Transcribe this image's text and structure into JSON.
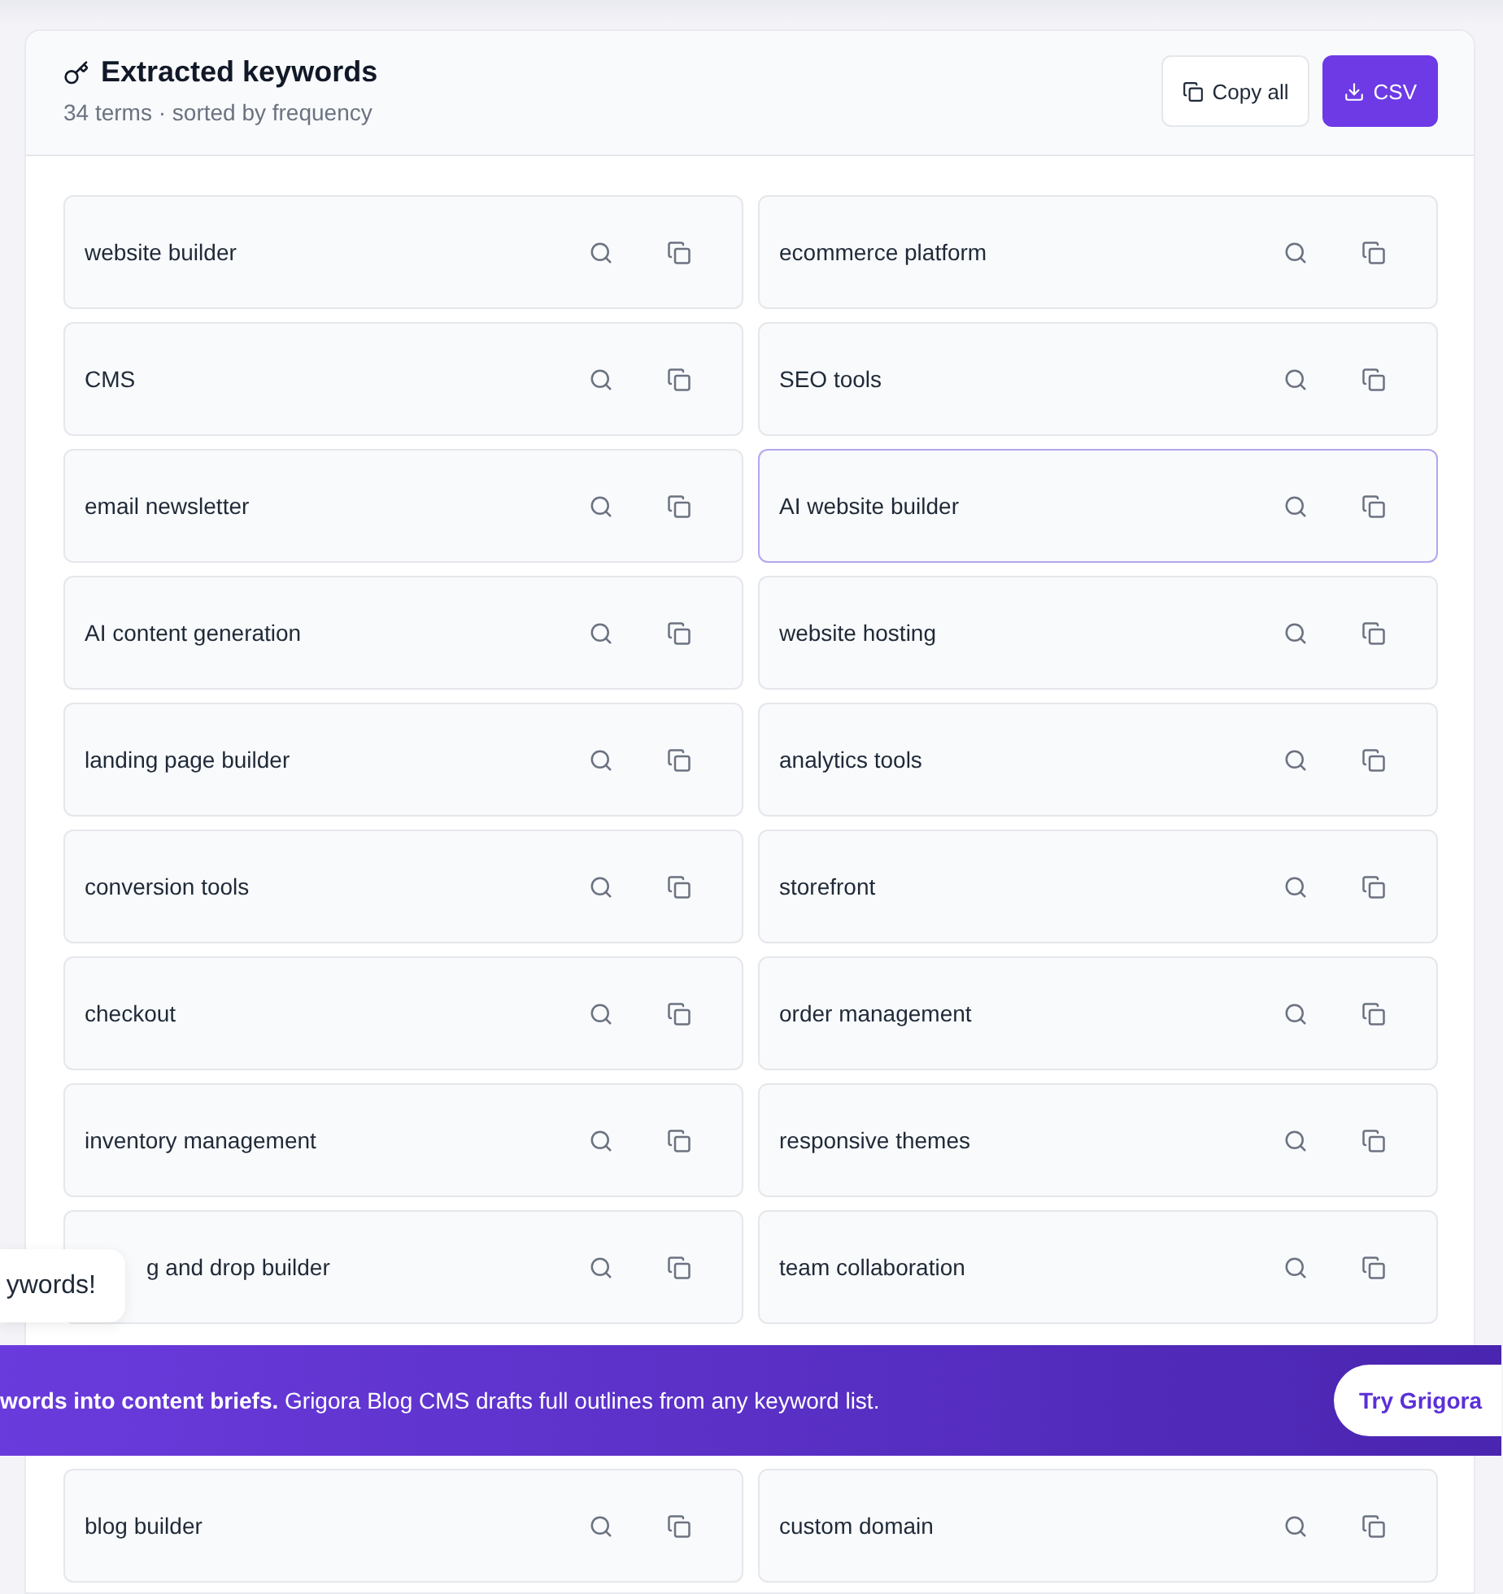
{
  "header": {
    "title": "Extracted keywords",
    "subtitle": "34 terms · sorted by frequency",
    "buttons": [
      {
        "kind": "copy",
        "label": "Copy all"
      },
      {
        "kind": "download",
        "label": "CSV"
      }
    ]
  },
  "keywords": [
    {
      "text": "website builder",
      "highlighted": false,
      "partially_hidden": false
    },
    {
      "text": "ecommerce platform",
      "highlighted": false,
      "partially_hidden": false
    },
    {
      "text": "CMS",
      "highlighted": false,
      "partially_hidden": false
    },
    {
      "text": "SEO tools",
      "highlighted": false,
      "partially_hidden": false
    },
    {
      "text": "email newsletter",
      "highlighted": false,
      "partially_hidden": false
    },
    {
      "text": "AI website builder",
      "highlighted": true,
      "partially_hidden": false
    },
    {
      "text": "AI content generation",
      "highlighted": false,
      "partially_hidden": false
    },
    {
      "text": "website hosting",
      "highlighted": false,
      "partially_hidden": false
    },
    {
      "text": "landing page builder",
      "highlighted": false,
      "partially_hidden": false
    },
    {
      "text": "analytics tools",
      "highlighted": false,
      "partially_hidden": false
    },
    {
      "text": "conversion tools",
      "highlighted": false,
      "partially_hidden": false
    },
    {
      "text": "storefront",
      "highlighted": false,
      "partially_hidden": false
    },
    {
      "text": "checkout",
      "highlighted": false,
      "partially_hidden": false
    },
    {
      "text": "order management",
      "highlighted": false,
      "partially_hidden": false
    },
    {
      "text": "inventory management",
      "highlighted": false,
      "partially_hidden": false
    },
    {
      "text": "responsive themes",
      "highlighted": false,
      "partially_hidden": false
    },
    {
      "text": "g and drop builder",
      "highlighted": false,
      "partially_hidden": true
    },
    {
      "text": "team collaboration",
      "highlighted": false,
      "partially_hidden": false
    }
  ],
  "banner": {
    "text": "**words into content briefs.** Grigora Blog CMS drafts full outlines from any keyword list.",
    "button": "Try Grigora"
  },
  "keywords_below": [
    {
      "text": "blog builder",
      "highlighted": false,
      "partially_hidden": false
    },
    {
      "text": "custom domain",
      "highlighted": false,
      "partially_hidden": false
    }
  ],
  "toast": {
    "text": "ywords!"
  }
}
